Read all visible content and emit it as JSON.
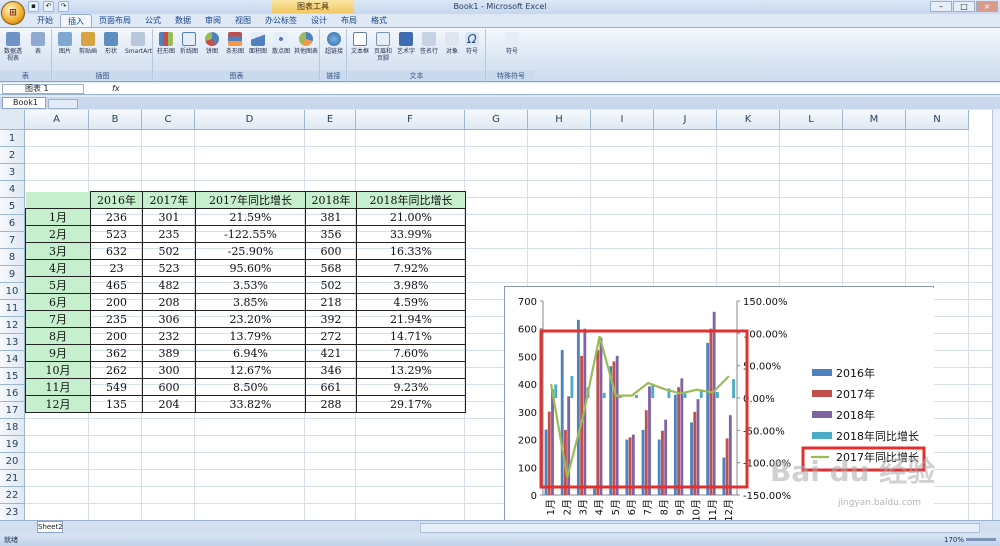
{
  "window": {
    "title": "Book1 - Microsoft Excel",
    "contextual_tab": "图表工具",
    "office_button": "⊞"
  },
  "ribbon_tabs": [
    "开始",
    "插入",
    "页面布局",
    "公式",
    "数据",
    "审阅",
    "视图",
    "办公标签",
    "设计",
    "布局",
    "格式"
  ],
  "ribbon": {
    "groups": [
      "表",
      "插图",
      "图表",
      "链接",
      "文本",
      "特殊符号"
    ],
    "buttons": [
      "数据透视表",
      "表",
      "图片",
      "剪贴画",
      "形状",
      "SmartArt",
      "柱形图",
      "折线图",
      "饼图",
      "条形图",
      "面积图",
      "散点图",
      "其他图表",
      "超链接",
      "文本框",
      "页眉和页脚",
      "艺术字",
      "签名行",
      "对象",
      "符号",
      "符号"
    ]
  },
  "formula_bar": {
    "name_box": "图表 1",
    "fx": "fx"
  },
  "document_tab": "Book1",
  "columns": [
    "A",
    "B",
    "C",
    "D",
    "E",
    "F",
    "G",
    "H",
    "I",
    "J",
    "K",
    "L",
    "M",
    "N"
  ],
  "rows": [
    "1",
    "2",
    "3",
    "4",
    "5",
    "6",
    "7",
    "8",
    "9",
    "10",
    "11",
    "12",
    "13",
    "14",
    "15",
    "16",
    "17",
    "18",
    "19",
    "20",
    "21",
    "22",
    "23"
  ],
  "table": {
    "headers": [
      "2016年",
      "2017年",
      "2017年同比增长",
      "2018年",
      "2018年同比增长"
    ],
    "rows": [
      [
        "1月",
        "236",
        "301",
        "21.59%",
        "381",
        "21.00%"
      ],
      [
        "2月",
        "523",
        "235",
        "-122.55%",
        "356",
        "33.99%"
      ],
      [
        "3月",
        "632",
        "502",
        "-25.90%",
        "600",
        "16.33%"
      ],
      [
        "4月",
        "23",
        "523",
        "95.60%",
        "568",
        "7.92%"
      ],
      [
        "5月",
        "465",
        "482",
        "3.53%",
        "502",
        "3.98%"
      ],
      [
        "6月",
        "200",
        "208",
        "3.85%",
        "218",
        "4.59%"
      ],
      [
        "7月",
        "235",
        "306",
        "23.20%",
        "392",
        "21.94%"
      ],
      [
        "8月",
        "200",
        "232",
        "13.79%",
        "272",
        "14.71%"
      ],
      [
        "9月",
        "362",
        "389",
        "6.94%",
        "421",
        "7.60%"
      ],
      [
        "10月",
        "262",
        "300",
        "12.67%",
        "346",
        "13.29%"
      ],
      [
        "11月",
        "549",
        "600",
        "8.50%",
        "661",
        "9.23%"
      ],
      [
        "12月",
        "135",
        "204",
        "33.82%",
        "288",
        "29.17%"
      ]
    ]
  },
  "chart_data": {
    "type": "bar",
    "categories": [
      "1月",
      "2月",
      "3月",
      "4月",
      "5月",
      "6月",
      "7月",
      "8月",
      "9月",
      "10月",
      "11月",
      "12月"
    ],
    "series": [
      {
        "name": "2016年",
        "values": [
          236,
          523,
          632,
          23,
          465,
          200,
          235,
          200,
          362,
          262,
          549,
          135
        ],
        "color": "#4f81bd"
      },
      {
        "name": "2017年",
        "values": [
          301,
          235,
          502,
          523,
          482,
          208,
          306,
          232,
          389,
          300,
          600,
          204
        ],
        "color": "#c0504d"
      },
      {
        "name": "2018年",
        "values": [
          381,
          356,
          600,
          568,
          502,
          218,
          392,
          272,
          421,
          346,
          661,
          288
        ],
        "color": "#8064a2"
      },
      {
        "name": "2018年同比增长",
        "values": [
          21.0,
          33.99,
          16.33,
          7.92,
          3.98,
          4.59,
          21.94,
          14.71,
          7.6,
          13.29,
          9.23,
          29.17
        ],
        "color": "#4bacc6",
        "axis": "secondary",
        "kind": "bar"
      },
      {
        "name": "2017年同比增长",
        "values": [
          21.59,
          -122.55,
          -25.9,
          95.6,
          3.53,
          3.85,
          23.2,
          13.79,
          6.94,
          12.67,
          8.5,
          33.82
        ],
        "color": "#9bbb59",
        "axis": "secondary",
        "kind": "line"
      }
    ],
    "ylim": [
      0,
      700
    ],
    "yticks": [
      "0",
      "100",
      "200",
      "300",
      "400",
      "500",
      "600",
      "700"
    ],
    "y2lim": [
      -150,
      150
    ],
    "y2ticks": [
      "150.00%",
      "100.00%",
      "50.00%",
      "0.00%",
      "-50.00%",
      "-100.00%",
      "-150.00%"
    ],
    "legend_position": "right",
    "highlight_color": "#e03030"
  },
  "sheet_tab": "Sheet2",
  "status": {
    "ready": "就绪",
    "zoom": "170%"
  },
  "watermark": {
    "logo": "Bai du 经验",
    "url": "jingyan.baidu.com"
  }
}
